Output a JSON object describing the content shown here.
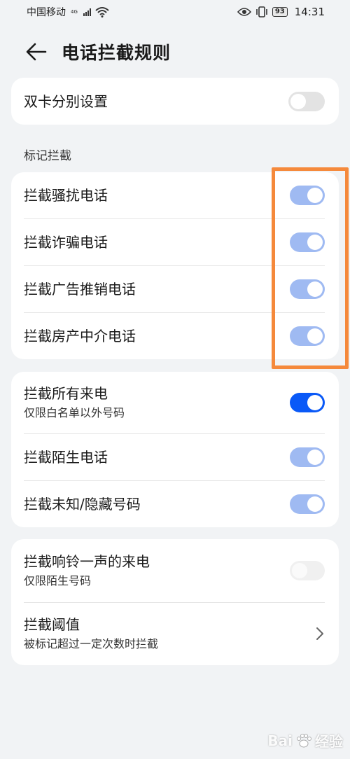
{
  "status_bar": {
    "carrier": "中国移动",
    "network_type": "4G",
    "battery": "93",
    "time": "14:31"
  },
  "header": {
    "title": "电话拦截规则"
  },
  "dual_sim": {
    "label": "双卡分别设置",
    "enabled": false
  },
  "mark_section": {
    "label": "标记拦截",
    "items": [
      {
        "label": "拦截骚扰电话",
        "enabled": true
      },
      {
        "label": "拦截诈骗电话",
        "enabled": true
      },
      {
        "label": "拦截广告推销电话",
        "enabled": true
      },
      {
        "label": "拦截房产中介电话",
        "enabled": true
      }
    ]
  },
  "incoming": {
    "items": [
      {
        "label": "拦截所有来电",
        "sub": "仅限白名单以外号码",
        "enabled": true
      },
      {
        "label": "拦截陌生电话",
        "enabled": true
      },
      {
        "label": "拦截未知/隐藏号码",
        "enabled": true
      }
    ]
  },
  "ring_once": {
    "label": "拦截响铃一声的来电",
    "sub": "仅限陌生号码",
    "enabled": false
  },
  "threshold": {
    "label": "拦截阈值",
    "sub": "被标记超过一定次数时拦截"
  },
  "watermark": {
    "text": "Bai",
    "text2": "经验"
  },
  "colors": {
    "accent": "#0a59f7",
    "accent_dim": "#9fbaf2",
    "highlight": "#f5893b",
    "background": "#f1f3f5"
  }
}
